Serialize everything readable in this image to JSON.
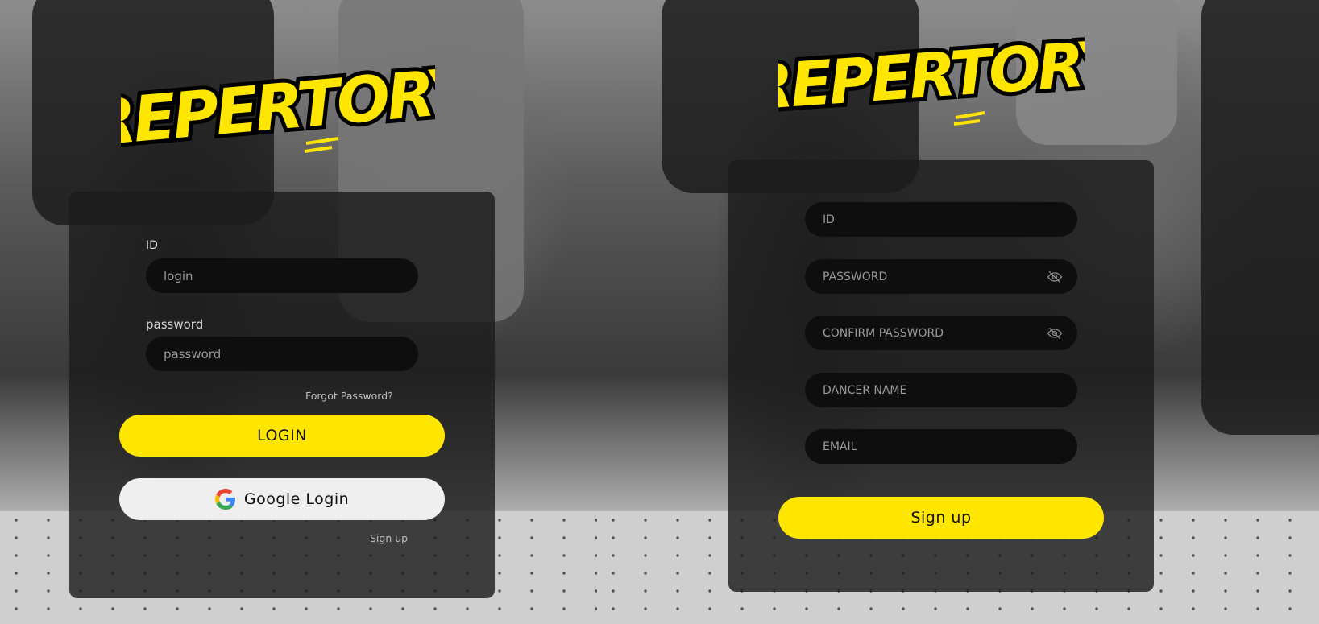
{
  "login_screen": {
    "logo_text": "REPERTORY",
    "id_label": "ID",
    "id_placeholder": "login",
    "password_label": "password",
    "password_placeholder": "password",
    "forgot_password": "Forgot Password?",
    "login_button": "LOGIN",
    "google_button": "Google Login",
    "signup_link": "Sign up"
  },
  "signup_screen": {
    "logo_text": "REPERTORY",
    "id_placeholder": "ID",
    "password_placeholder": "PASSWORD",
    "confirm_password_placeholder": "CONFIRM PASSWORD",
    "dancer_name_placeholder": "DANCER NAME",
    "email_placeholder": "EMAIL",
    "signup_button": "Sign up"
  },
  "colors": {
    "accent": "#ffe600",
    "card": "#1c1c1c",
    "field": "#0e0e0e"
  },
  "icons": {
    "password_toggle": "eye-off-icon",
    "google": "google-icon"
  }
}
